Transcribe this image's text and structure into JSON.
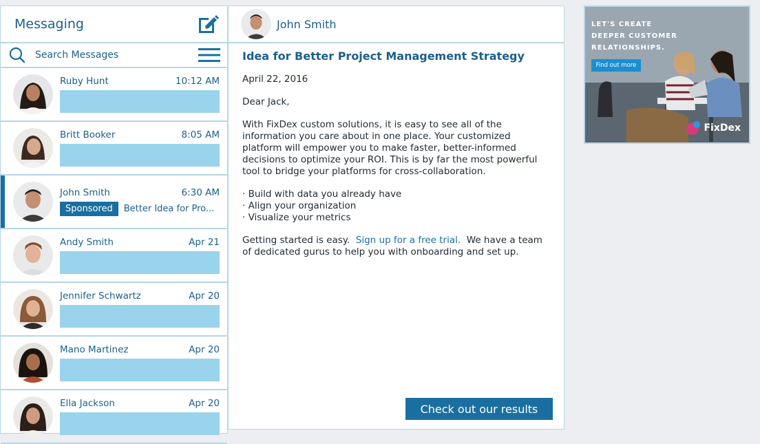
{
  "sidebar": {
    "title": "Messaging",
    "search_placeholder": "Search Messages",
    "conversations": [
      {
        "name": "Ruby Hunt",
        "time": "10:12 AM"
      },
      {
        "name": "Britt Booker",
        "time": "8:05 AM"
      },
      {
        "name": "John Smith",
        "time": "6:30 AM",
        "badge": "Sponsored",
        "preview": "Better Idea for Pro..."
      },
      {
        "name": "Andy Smith",
        "time": "Apr 21"
      },
      {
        "name": "Jennifer Schwartz",
        "time": "Apr 20"
      },
      {
        "name": "Mano Martinez",
        "time": "Apr 20"
      },
      {
        "name": "Ella Jackson",
        "time": "Apr 20"
      }
    ]
  },
  "message": {
    "sender": "John Smith",
    "subject": "Idea for Better Project Management Strategy",
    "date": "April 22, 2016",
    "greeting": "Dear Jack,",
    "body": "With FixDex custom solutions, it is easy to see all of the information you care about in one place. Your customized platform will empower you to make faster, better-informed decisions to optimize your ROI. This is by far the most powerful tool to bridge your platforms for cross-collaboration.",
    "bullets": [
      "Build with data you already have",
      "Align your organization",
      "Visualize your metrics"
    ],
    "closing_start": "Getting started is easy.",
    "closing_link": "Sign up for a free trial.",
    "closing_end": "We have a team of dedicated gurus to help you with onboarding and set up.",
    "cta_label": "Check out our results"
  },
  "ad": {
    "headline": "LET'S CREATE DEEPER CUSTOMER RELATIONSHIPS.",
    "button_label": "Find out more",
    "brand": "FixDex"
  },
  "colors": {
    "accent": "#1a6fa0",
    "text_blue": "#1c5f8a",
    "preview_bar": "#9ad3ec",
    "border": "#b7d6e6",
    "background": "#eceef1"
  }
}
